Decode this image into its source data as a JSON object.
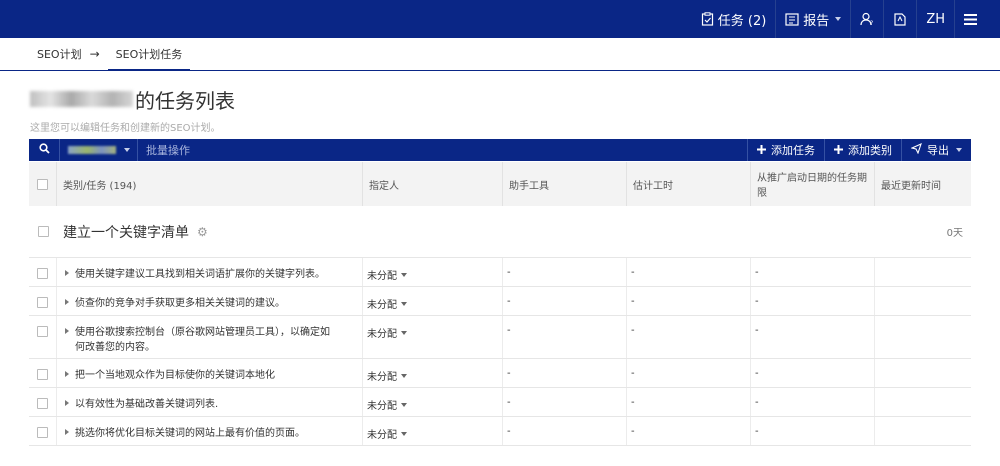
{
  "topbar": {
    "tasks_label": "任务 (2)",
    "report_label": "报告",
    "lang_label": "ZH",
    "icons": [
      "clipboard-icon",
      "report-icon",
      "user-question-icon",
      "book-icon",
      "menu-icon"
    ]
  },
  "breadcrumb": {
    "parent": "SEO计划",
    "arrow": "→",
    "current": "SEO计划任务"
  },
  "page": {
    "title_suffix": "的任务列表",
    "subtitle": "这里您可以编辑任务和创建新的SEO计划。"
  },
  "toolbar": {
    "batch_label": "批量操作",
    "add_task_label": "添加任务",
    "add_category_label": "添加类别",
    "export_label": "导出"
  },
  "table": {
    "headers": {
      "task": "类别/任务 (194)",
      "assignee": "指定人",
      "tool": "助手工具",
      "estimate": "估计工时",
      "due": "从推广启动日期的任务期限",
      "updated": "最近更新时间"
    },
    "group": {
      "title": "建立一个关键字清单",
      "days": "0天"
    },
    "rows": [
      {
        "task": "使用关键字建议工具找到相关词语扩展你的关键字列表。",
        "assignee": "未分配",
        "tool": "-",
        "estimate": "-",
        "due": "-",
        "updated": ""
      },
      {
        "task": "侦查你的竞争对手获取更多相关关键词的建议。",
        "assignee": "未分配",
        "tool": "-",
        "estimate": "-",
        "due": "-",
        "updated": ""
      },
      {
        "task": "使用谷歌搜索控制台（原谷歌网站管理员工具），以确定如何改善您的内容。",
        "assignee": "未分配",
        "tool": "-",
        "estimate": "-",
        "due": "-",
        "updated": ""
      },
      {
        "task": "把一个当地观众作为目标使你的关键词本地化",
        "assignee": "未分配",
        "tool": "-",
        "estimate": "-",
        "due": "-",
        "updated": ""
      },
      {
        "task": "以有效性为基础改善关键词列表.",
        "assignee": "未分配",
        "tool": "-",
        "estimate": "-",
        "due": "-",
        "updated": ""
      },
      {
        "task": "挑选你将优化目标关键词的网站上最有价值的页面。",
        "assignee": "未分配",
        "tool": "-",
        "estimate": "-",
        "due": "-",
        "updated": ""
      }
    ]
  },
  "colors": {
    "brand_navy": "#0a2686",
    "header_bg": "#f3f3f3"
  }
}
